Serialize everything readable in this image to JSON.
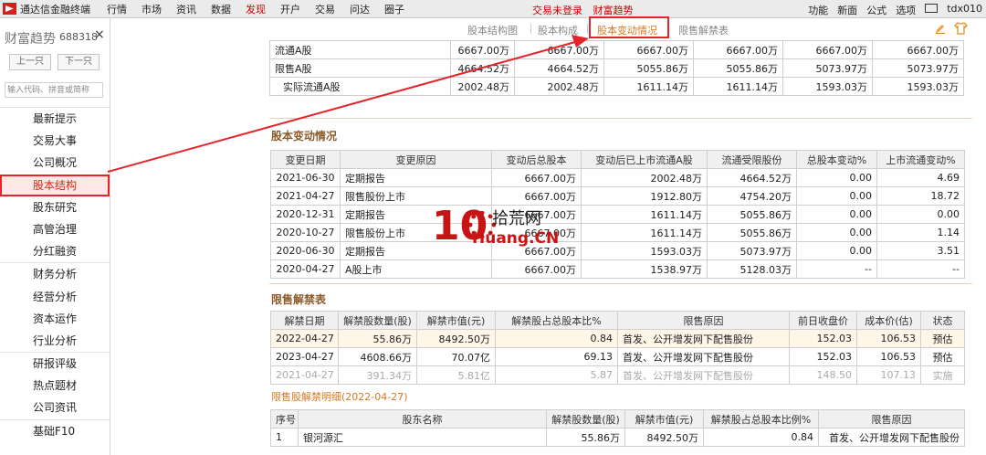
{
  "menubar": {
    "app_title": "通达信金融终端",
    "items": [
      "行情",
      "市场",
      "资讯",
      "数据",
      "发现",
      "开户",
      "交易",
      "问达",
      "圈子"
    ],
    "active_index": 4,
    "center_links": [
      "交易未登录",
      "财富趋势"
    ],
    "right_items": [
      "功能",
      "新面",
      "公式",
      "选项"
    ],
    "user": "tdx010"
  },
  "sidebar": {
    "title": "财富趋势",
    "code": "688318",
    "close": "×",
    "prev_label": "上一只",
    "next_label": "下一只",
    "search_placeholder": "输入代码、拼音或简称",
    "items": [
      "最新提示",
      "交易大事",
      "公司概况",
      "股本结构",
      "股东研究",
      "高管治理",
      "分红融资",
      "财务分析",
      "经营分析",
      "资本运作",
      "行业分析",
      "研报评级",
      "热点题材",
      "公司资讯",
      "基础F10"
    ],
    "active_index": 3
  },
  "tabs": {
    "items": [
      "股本结构图",
      "股本构成",
      "股本变动情况",
      "限售解禁表"
    ],
    "active_index": 2
  },
  "top_table": {
    "rows": [
      {
        "label": "流通A股",
        "values": [
          "6667.00万",
          "6667.00万",
          "6667.00万",
          "6667.00万",
          "6667.00万",
          "6667.00万"
        ]
      },
      {
        "label": "限售A股",
        "values": [
          "4664.52万",
          "4664.52万",
          "5055.86万",
          "5055.86万",
          "5073.97万",
          "5073.97万"
        ]
      },
      {
        "label": "实际流通A股",
        "values": [
          "2002.48万",
          "2002.48万",
          "1611.14万",
          "1611.14万",
          "1593.03万",
          "1593.03万"
        ]
      }
    ]
  },
  "change_section": {
    "title": "股本变动情况",
    "headers": [
      "变更日期",
      "变更原因",
      "变动后总股本",
      "变动后已上市流通A股",
      "流通受限股份",
      "总股本变动%",
      "上市流通变动%"
    ],
    "rows": [
      [
        "2021-06-30",
        "定期报告",
        "6667.00万",
        "2002.48万",
        "4664.52万",
        "0.00",
        "4.69"
      ],
      [
        "2021-04-27",
        "限售股份上市",
        "6667.00万",
        "1912.80万",
        "4754.20万",
        "0.00",
        "18.72"
      ],
      [
        "2020-12-31",
        "定期报告",
        "6667.00万",
        "1611.14万",
        "5055.86万",
        "0.00",
        "0.00"
      ],
      [
        "2020-10-27",
        "限售股份上市",
        "6667.00万",
        "1611.14万",
        "5055.86万",
        "0.00",
        "1.14"
      ],
      [
        "2020-06-30",
        "定期报告",
        "6667.00万",
        "1593.03万",
        "5073.97万",
        "0.00",
        "3.51"
      ],
      [
        "2020-04-27",
        "A股上市",
        "6667.00万",
        "1538.97万",
        "5128.03万",
        "--",
        "--"
      ]
    ]
  },
  "unlock_section": {
    "title": "限售解禁表",
    "headers": [
      "解禁日期",
      "解禁股数量(股)",
      "解禁市值(元)",
      "解禁股占总股本比%",
      "限售原因",
      "前日收盘价",
      "成本价(估)",
      "状态"
    ],
    "rows": [
      [
        "2022-04-27",
        "55.86万",
        "8492.50万",
        "0.84",
        "首发、公开增发网下配售股份",
        "152.03",
        "106.53",
        "预估"
      ],
      [
        "2023-04-27",
        "4608.66万",
        "70.07亿",
        "69.13",
        "首发、公开增发网下配售股份",
        "152.03",
        "106.53",
        "预估"
      ],
      [
        "2021-04-27",
        "391.34万",
        "5.81亿",
        "5.87",
        "首发、公开增发网下配售股份",
        "148.50",
        "107.13",
        "实施"
      ]
    ]
  },
  "detail_section": {
    "title": "限售股解禁明细(2022-04-27)",
    "headers": [
      "序号",
      "股东名称",
      "解禁股数量(股)",
      "解禁市值(元)",
      "解禁股占总股本比例%",
      "限售原因"
    ],
    "rows": [
      [
        "1",
        "银河源汇",
        "55.86万",
        "8492.50万",
        "0.84",
        "首发、公开增发网下配售股份"
      ]
    ]
  },
  "watermark": {
    "number": "10",
    "text_cn": "拾荒网",
    "text_en": "Huang.CN"
  },
  "colors": {
    "accent_red": "#e3242b",
    "section_brown": "#8b5a2b",
    "tab_orange": "#d47a22"
  }
}
